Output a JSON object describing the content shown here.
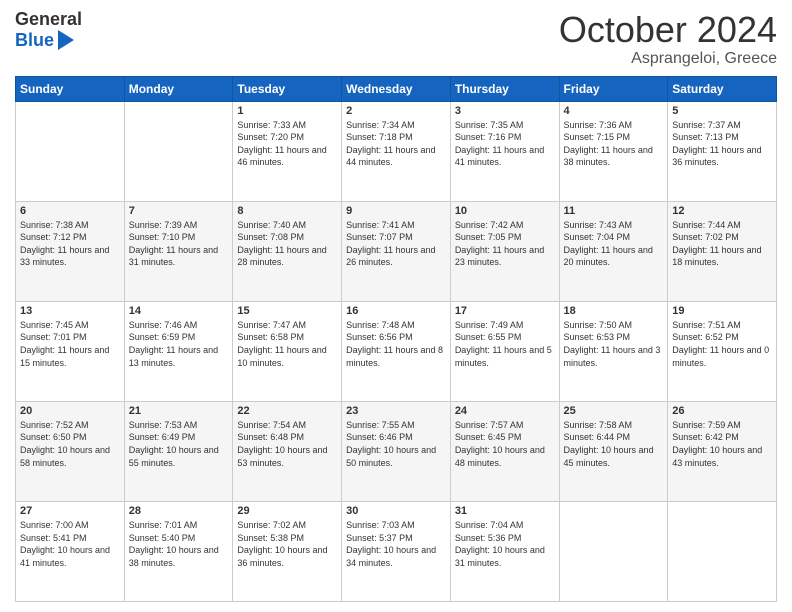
{
  "header": {
    "logo_general": "General",
    "logo_blue": "Blue",
    "month_title": "October 2024",
    "location": "Asprangeloi, Greece"
  },
  "weekdays": [
    "Sunday",
    "Monday",
    "Tuesday",
    "Wednesday",
    "Thursday",
    "Friday",
    "Saturday"
  ],
  "weeks": [
    [
      null,
      null,
      {
        "day": 1,
        "sunrise": "Sunrise: 7:33 AM",
        "sunset": "Sunset: 7:20 PM",
        "daylight": "Daylight: 11 hours and 46 minutes."
      },
      {
        "day": 2,
        "sunrise": "Sunrise: 7:34 AM",
        "sunset": "Sunset: 7:18 PM",
        "daylight": "Daylight: 11 hours and 44 minutes."
      },
      {
        "day": 3,
        "sunrise": "Sunrise: 7:35 AM",
        "sunset": "Sunset: 7:16 PM",
        "daylight": "Daylight: 11 hours and 41 minutes."
      },
      {
        "day": 4,
        "sunrise": "Sunrise: 7:36 AM",
        "sunset": "Sunset: 7:15 PM",
        "daylight": "Daylight: 11 hours and 38 minutes."
      },
      {
        "day": 5,
        "sunrise": "Sunrise: 7:37 AM",
        "sunset": "Sunset: 7:13 PM",
        "daylight": "Daylight: 11 hours and 36 minutes."
      }
    ],
    [
      {
        "day": 6,
        "sunrise": "Sunrise: 7:38 AM",
        "sunset": "Sunset: 7:12 PM",
        "daylight": "Daylight: 11 hours and 33 minutes."
      },
      {
        "day": 7,
        "sunrise": "Sunrise: 7:39 AM",
        "sunset": "Sunset: 7:10 PM",
        "daylight": "Daylight: 11 hours and 31 minutes."
      },
      {
        "day": 8,
        "sunrise": "Sunrise: 7:40 AM",
        "sunset": "Sunset: 7:08 PM",
        "daylight": "Daylight: 11 hours and 28 minutes."
      },
      {
        "day": 9,
        "sunrise": "Sunrise: 7:41 AM",
        "sunset": "Sunset: 7:07 PM",
        "daylight": "Daylight: 11 hours and 26 minutes."
      },
      {
        "day": 10,
        "sunrise": "Sunrise: 7:42 AM",
        "sunset": "Sunset: 7:05 PM",
        "daylight": "Daylight: 11 hours and 23 minutes."
      },
      {
        "day": 11,
        "sunrise": "Sunrise: 7:43 AM",
        "sunset": "Sunset: 7:04 PM",
        "daylight": "Daylight: 11 hours and 20 minutes."
      },
      {
        "day": 12,
        "sunrise": "Sunrise: 7:44 AM",
        "sunset": "Sunset: 7:02 PM",
        "daylight": "Daylight: 11 hours and 18 minutes."
      }
    ],
    [
      {
        "day": 13,
        "sunrise": "Sunrise: 7:45 AM",
        "sunset": "Sunset: 7:01 PM",
        "daylight": "Daylight: 11 hours and 15 minutes."
      },
      {
        "day": 14,
        "sunrise": "Sunrise: 7:46 AM",
        "sunset": "Sunset: 6:59 PM",
        "daylight": "Daylight: 11 hours and 13 minutes."
      },
      {
        "day": 15,
        "sunrise": "Sunrise: 7:47 AM",
        "sunset": "Sunset: 6:58 PM",
        "daylight": "Daylight: 11 hours and 10 minutes."
      },
      {
        "day": 16,
        "sunrise": "Sunrise: 7:48 AM",
        "sunset": "Sunset: 6:56 PM",
        "daylight": "Daylight: 11 hours and 8 minutes."
      },
      {
        "day": 17,
        "sunrise": "Sunrise: 7:49 AM",
        "sunset": "Sunset: 6:55 PM",
        "daylight": "Daylight: 11 hours and 5 minutes."
      },
      {
        "day": 18,
        "sunrise": "Sunrise: 7:50 AM",
        "sunset": "Sunset: 6:53 PM",
        "daylight": "Daylight: 11 hours and 3 minutes."
      },
      {
        "day": 19,
        "sunrise": "Sunrise: 7:51 AM",
        "sunset": "Sunset: 6:52 PM",
        "daylight": "Daylight: 11 hours and 0 minutes."
      }
    ],
    [
      {
        "day": 20,
        "sunrise": "Sunrise: 7:52 AM",
        "sunset": "Sunset: 6:50 PM",
        "daylight": "Daylight: 10 hours and 58 minutes."
      },
      {
        "day": 21,
        "sunrise": "Sunrise: 7:53 AM",
        "sunset": "Sunset: 6:49 PM",
        "daylight": "Daylight: 10 hours and 55 minutes."
      },
      {
        "day": 22,
        "sunrise": "Sunrise: 7:54 AM",
        "sunset": "Sunset: 6:48 PM",
        "daylight": "Daylight: 10 hours and 53 minutes."
      },
      {
        "day": 23,
        "sunrise": "Sunrise: 7:55 AM",
        "sunset": "Sunset: 6:46 PM",
        "daylight": "Daylight: 10 hours and 50 minutes."
      },
      {
        "day": 24,
        "sunrise": "Sunrise: 7:57 AM",
        "sunset": "Sunset: 6:45 PM",
        "daylight": "Daylight: 10 hours and 48 minutes."
      },
      {
        "day": 25,
        "sunrise": "Sunrise: 7:58 AM",
        "sunset": "Sunset: 6:44 PM",
        "daylight": "Daylight: 10 hours and 45 minutes."
      },
      {
        "day": 26,
        "sunrise": "Sunrise: 7:59 AM",
        "sunset": "Sunset: 6:42 PM",
        "daylight": "Daylight: 10 hours and 43 minutes."
      }
    ],
    [
      {
        "day": 27,
        "sunrise": "Sunrise: 7:00 AM",
        "sunset": "Sunset: 5:41 PM",
        "daylight": "Daylight: 10 hours and 41 minutes."
      },
      {
        "day": 28,
        "sunrise": "Sunrise: 7:01 AM",
        "sunset": "Sunset: 5:40 PM",
        "daylight": "Daylight: 10 hours and 38 minutes."
      },
      {
        "day": 29,
        "sunrise": "Sunrise: 7:02 AM",
        "sunset": "Sunset: 5:38 PM",
        "daylight": "Daylight: 10 hours and 36 minutes."
      },
      {
        "day": 30,
        "sunrise": "Sunrise: 7:03 AM",
        "sunset": "Sunset: 5:37 PM",
        "daylight": "Daylight: 10 hours and 34 minutes."
      },
      {
        "day": 31,
        "sunrise": "Sunrise: 7:04 AM",
        "sunset": "Sunset: 5:36 PM",
        "daylight": "Daylight: 10 hours and 31 minutes."
      },
      null,
      null
    ]
  ]
}
